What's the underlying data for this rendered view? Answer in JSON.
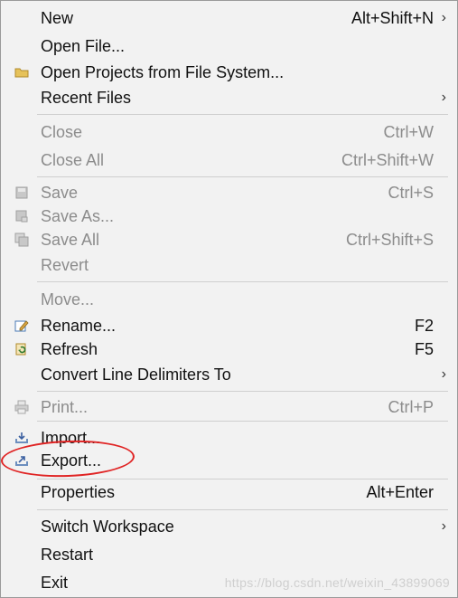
{
  "menu": {
    "items": [
      {
        "label": "New",
        "shortcut": "Alt+Shift+N",
        "submenu": true,
        "enabled": true
      },
      {
        "label": "Open File...",
        "shortcut": "",
        "submenu": false,
        "enabled": true
      },
      {
        "label": "Open Projects from File System...",
        "shortcut": "",
        "submenu": false,
        "enabled": true,
        "icon": "folder-icon"
      },
      {
        "label": "Recent Files",
        "shortcut": "",
        "submenu": true,
        "enabled": true
      },
      {
        "label": "Close",
        "shortcut": "Ctrl+W",
        "submenu": false,
        "enabled": false
      },
      {
        "label": "Close All",
        "shortcut": "Ctrl+Shift+W",
        "submenu": false,
        "enabled": false
      },
      {
        "label": "Save",
        "shortcut": "Ctrl+S",
        "submenu": false,
        "enabled": false,
        "icon": "save-icon"
      },
      {
        "label": "Save As...",
        "shortcut": "",
        "submenu": false,
        "enabled": false,
        "icon": "save-as-icon"
      },
      {
        "label": "Save All",
        "shortcut": "Ctrl+Shift+S",
        "submenu": false,
        "enabled": false,
        "icon": "save-all-icon"
      },
      {
        "label": "Revert",
        "shortcut": "",
        "submenu": false,
        "enabled": false
      },
      {
        "label": "Move...",
        "shortcut": "",
        "submenu": false,
        "enabled": false
      },
      {
        "label": "Rename...",
        "shortcut": "F2",
        "submenu": false,
        "enabled": true,
        "icon": "rename-icon"
      },
      {
        "label": "Refresh",
        "shortcut": "F5",
        "submenu": false,
        "enabled": true,
        "icon": "refresh-icon"
      },
      {
        "label": "Convert Line Delimiters To",
        "shortcut": "",
        "submenu": true,
        "enabled": true
      },
      {
        "label": "Print...",
        "shortcut": "Ctrl+P",
        "submenu": false,
        "enabled": false,
        "icon": "print-icon"
      },
      {
        "label": "Import...",
        "shortcut": "",
        "submenu": false,
        "enabled": true,
        "icon": "import-icon"
      },
      {
        "label": "Export...",
        "shortcut": "",
        "submenu": false,
        "enabled": true,
        "icon": "export-icon"
      },
      {
        "label": "Properties",
        "shortcut": "Alt+Enter",
        "submenu": false,
        "enabled": true
      },
      {
        "label": "Switch Workspace",
        "shortcut": "",
        "submenu": true,
        "enabled": true
      },
      {
        "label": "Restart",
        "shortcut": "",
        "submenu": false,
        "enabled": true
      },
      {
        "label": "Exit",
        "shortcut": "",
        "submenu": false,
        "enabled": true
      }
    ],
    "submenu_glyph": "›"
  },
  "watermark": "https://blog.csdn.net/weixin_43899069",
  "colors": {
    "background": "#f2f2f2",
    "disabled_text": "#8c8c8c",
    "annotation": "#e02424"
  }
}
